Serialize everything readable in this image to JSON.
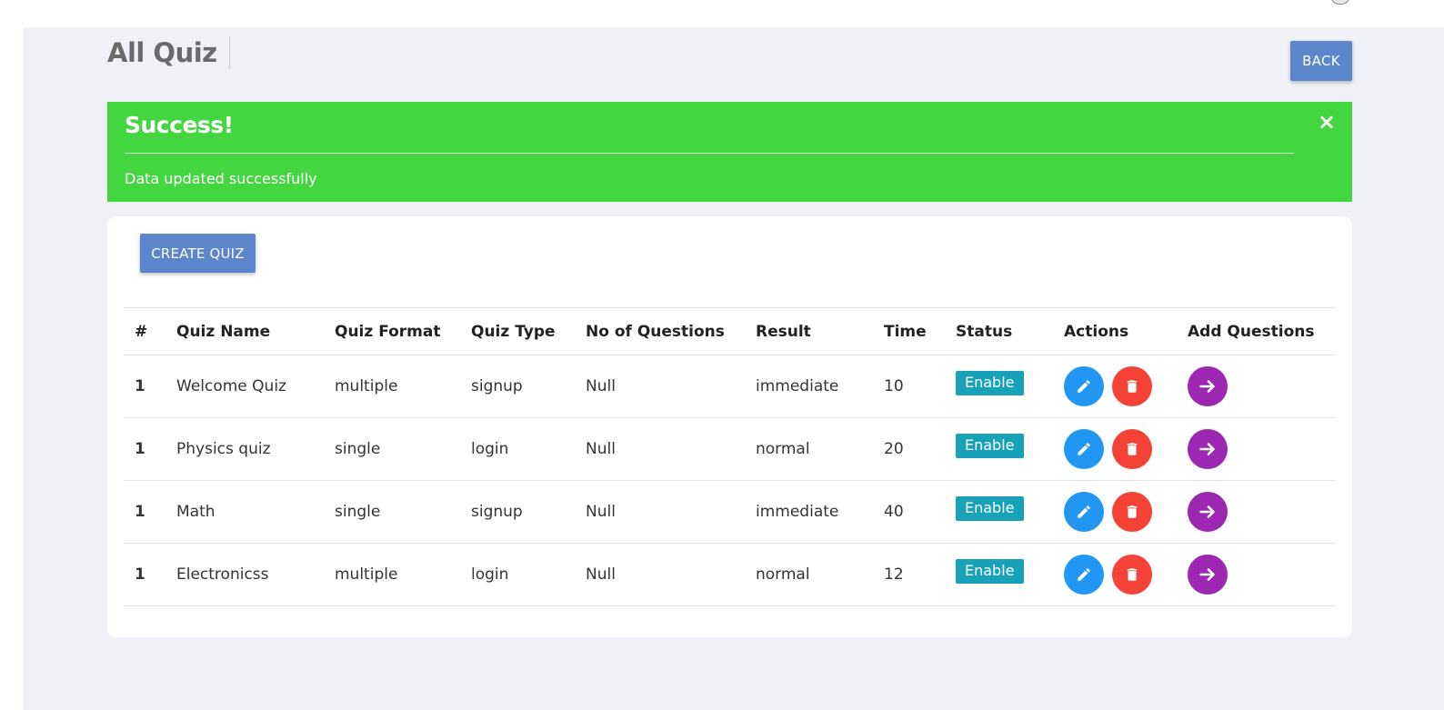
{
  "page": {
    "title": "All Quiz",
    "back_label": "BACK"
  },
  "alert": {
    "heading": "Success!",
    "message": "Data updated successfully",
    "close_glyph": "×"
  },
  "toolbar": {
    "create_label": "CREATE QUIZ"
  },
  "table": {
    "headers": [
      "#",
      "Quiz Name",
      "Quiz Format",
      "Quiz Type",
      "No of Questions",
      "Result",
      "Time",
      "Status",
      "Actions",
      "Add Questions"
    ],
    "rows": [
      {
        "num": "1",
        "name": "Welcome Quiz",
        "format": "multiple",
        "type": "signup",
        "questions": "Null",
        "result": "immediate",
        "time": "10",
        "status": "Enable"
      },
      {
        "num": "1",
        "name": "Physics quiz",
        "format": "single",
        "type": "login",
        "questions": "Null",
        "result": "normal",
        "time": "20",
        "status": "Enable"
      },
      {
        "num": "1",
        "name": "Math",
        "format": "single",
        "type": "signup",
        "questions": "Null",
        "result": "immediate",
        "time": "40",
        "status": "Enable"
      },
      {
        "num": "1",
        "name": "Electronicss",
        "format": "multiple",
        "type": "login",
        "questions": "Null",
        "result": "normal",
        "time": "12",
        "status": "Enable"
      }
    ]
  },
  "icons": {
    "edit": "pencil-icon",
    "delete": "trash-icon",
    "add_questions": "arrow-right-icon"
  },
  "colors": {
    "primary": "#5b86cc",
    "success": "#44d641",
    "badge": "#17a2b8",
    "edit": "#2196f3",
    "delete": "#f44336",
    "add_questions": "#9c27b0"
  }
}
